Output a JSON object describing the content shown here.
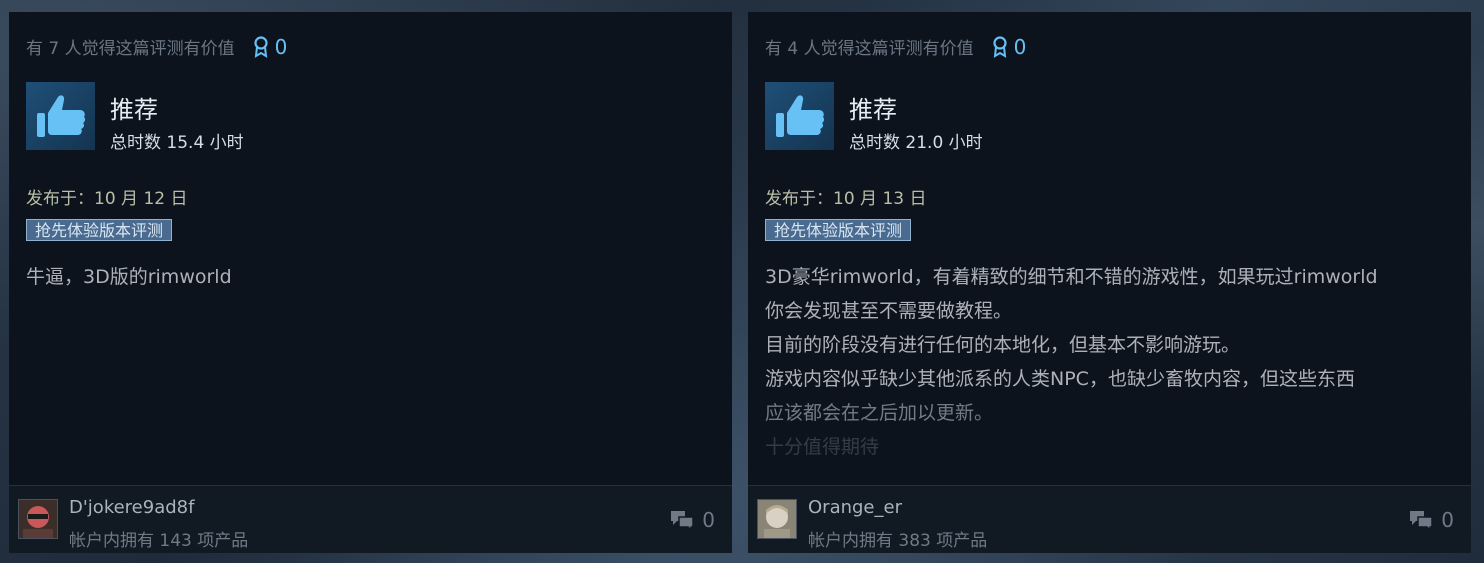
{
  "reviews": [
    {
      "helpful_text": "有 7 人觉得这篇评测有价值",
      "award_count": "0",
      "verdict": "推荐",
      "hours": "总时数 15.4 小时",
      "posted": "发布于：10 月 12 日",
      "badge": "抢先体验版本评测",
      "lines": [
        "牛逼，3D版的rimworld"
      ],
      "author": "D'jokere9ad8f",
      "products": "帐户内拥有 143 项产品",
      "comment_count": "0"
    },
    {
      "helpful_text": "有 4 人觉得这篇评测有价值",
      "award_count": "0",
      "verdict": "推荐",
      "hours": "总时数 21.0 小时",
      "posted": "发布于：10 月 13 日",
      "badge": "抢先体验版本评测",
      "lines": [
        "3D豪华rimworld，有着精致的细节和不错的游戏性，如果玩过rimworld",
        "你会发现甚至不需要做教程。",
        "目前的阶段没有进行任何的本地化，但基本不影响游玩。",
        "游戏内容似乎缺少其他派系的人类NPC，也缺少畜牧内容，但这些东西",
        "应该都会在之后加以更新。",
        "十分值得期待"
      ],
      "author": "Orange_er",
      "products": "帐户内拥有 383 项产品",
      "comment_count": "0"
    }
  ],
  "colors": {
    "accent": "#66c0f4",
    "card_bg": "#0d131d",
    "badge_bg": "#4a6b8f"
  },
  "icons": {
    "award": "award-ribbon-icon",
    "thumb": "thumbs-up-icon",
    "comment": "comment-bubbles-icon"
  }
}
